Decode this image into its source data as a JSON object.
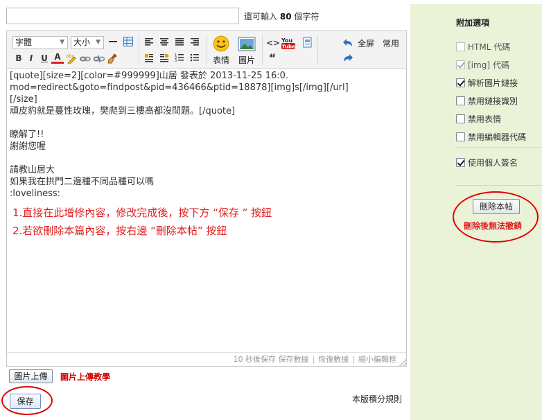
{
  "title": {
    "value": "",
    "hint_prefix": "還可輸入",
    "hint_count": "80",
    "hint_suffix": "個字符"
  },
  "toolbar": {
    "font_select": "字體",
    "size_select": "大小",
    "emoji_label": "表情",
    "image_label": "圖片",
    "fullscreen": "全屏",
    "common": "常用",
    "bold": "B",
    "italic": "I",
    "underline": "U",
    "font_color": "A",
    "quote": "“",
    "youtube": "You"
  },
  "content": {
    "lines": [
      "[quote][size=2][color=#999999]山居 發表於 2013-11-25 16:0.",
      "mod=redirect&goto=findpost&pid=436466&ptid=18878][img]s[/img][/url]",
      "[/size]",
      "頑皮豹就是蔓性玫瑰，樊爬到三樓高都沒問題。[/quote]",
      "",
      "瞭解了!!",
      "謝謝您喔",
      "",
      "請教山居大",
      "如果我在拱門二邊種不同品種可以嗎",
      ":loveliness:"
    ],
    "instructions": [
      "1.直接在此增修內容，修改完成後，按下方 “保存 ” 按鈕",
      "2.若欲刪除本篇內容，按右邊 “刪除本帖” 按鈕"
    ]
  },
  "statusbar": {
    "autosave": "10 秒後保存 保存數據",
    "restore": "恢復數據",
    "shrink": "縮小編輯框"
  },
  "upload": {
    "button": "圖片上傳",
    "tutorial": "圖片上傳教學"
  },
  "save_button": "保存",
  "rules_link": "本版積分規則",
  "side": {
    "title": "附加選項",
    "options": [
      {
        "label": "HTML 代碼",
        "checked": false,
        "disabled": true
      },
      {
        "label": "[img] 代碼",
        "checked": true,
        "disabled": true
      },
      {
        "label": "解析圖片鏈接",
        "checked": true,
        "disabled": false
      },
      {
        "label": "禁用鏈接識別",
        "checked": false,
        "disabled": false
      },
      {
        "label": "禁用表情",
        "checked": false,
        "disabled": false
      },
      {
        "label": "禁用編輯器代碼",
        "checked": false,
        "disabled": false
      }
    ],
    "signature": {
      "label": "使用個人簽名",
      "checked": true
    },
    "delete_button": "刪除本帖",
    "delete_warning": "刪除後無法撤銷"
  },
  "colors": {
    "side_bg": "#eaf2d8",
    "annotation_red": "#e00000",
    "instruction_red": "#e02020"
  }
}
